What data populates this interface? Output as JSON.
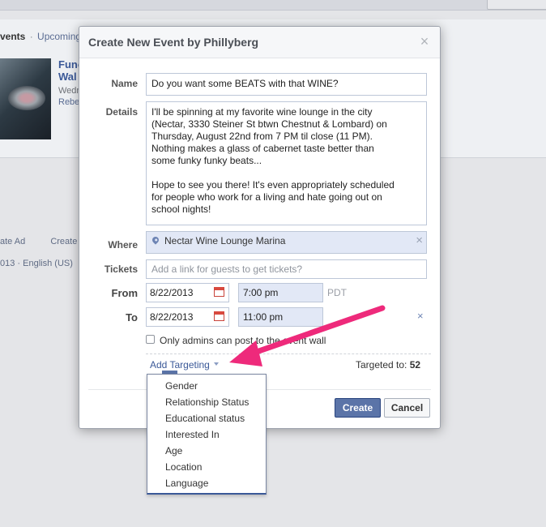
{
  "background": {
    "crumbs_events": "vents",
    "crumbs_separator": "·",
    "crumbs_upcoming": "Upcoming Ev",
    "event_title_line1": "Func",
    "event_title_line2": "Wal",
    "event_sub_line1": "Wedn",
    "event_sub_line2": "Rebe",
    "footer_create_ad": "ate Ad",
    "footer_create_page": "Create P",
    "footer_year": "013",
    "footer_separator": "·",
    "footer_language": "English (US)"
  },
  "dialog": {
    "title": "Create New Event by Phillyberg",
    "close_glyph": "×",
    "name_label": "Name",
    "name_value": "Do you want some BEATS with that WINE?",
    "details_label": "Details",
    "details_value": "I'll be spinning at my favorite wine lounge in the city\n(Nectar, 3330 Steiner St btwn Chestnut & Lombard) on\nThursday, August 22nd from 7 PM til close (11 PM).\nNothing makes a glass of cabernet taste better than\nsome funky funky beats...\n\nHope to see you there! It's even appropriately scheduled\nfor people who work for a living and hate going out on\nschool nights!",
    "where_label": "Where",
    "where_value": "Nectar Wine Lounge Marina",
    "where_clear_glyph": "×",
    "tickets_label": "Tickets",
    "tickets_placeholder": "Add a link for guests to get tickets?",
    "from_label": "From",
    "from_date": "8/22/2013",
    "from_time": "7:00 pm",
    "timezone": "PDT",
    "to_label": "To",
    "to_date": "8/22/2013",
    "to_time": "11:00 pm",
    "remove_end_glyph": "×",
    "admins_only_label": "Only admins can post to the event wall",
    "add_targeting_label": "Add Targeting",
    "targeted_label": "Targeted to:",
    "targeted_count": "52",
    "create_button": "Create",
    "cancel_button": "Cancel"
  },
  "targeting_menu": {
    "items": [
      "Gender",
      "Relationship Status",
      "Educational status",
      "Interested In",
      "Age",
      "Location",
      "Language"
    ]
  },
  "colors": {
    "accent": "#3b5998",
    "annotation_arrow": "#ee2a7b",
    "create_button": "#5b74a8"
  },
  "icons": {
    "close": "close-icon",
    "location": "location-pin-icon",
    "calendar": "calendar-icon",
    "dropdown": "caret-down-icon"
  }
}
